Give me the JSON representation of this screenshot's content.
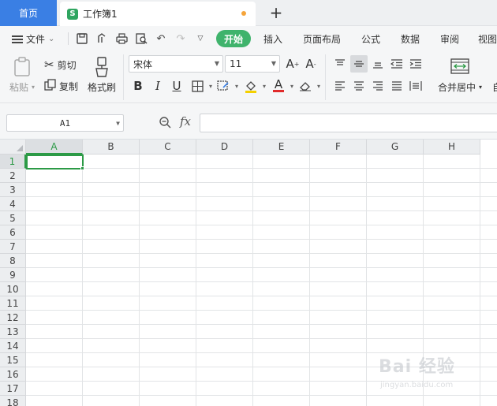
{
  "tabs": {
    "home": "首页",
    "document": "工作簿1"
  },
  "menu": {
    "file": "文件",
    "tabs": [
      {
        "label": "开始",
        "active": true
      },
      {
        "label": "插入"
      },
      {
        "label": "页面布局"
      },
      {
        "label": "公式"
      },
      {
        "label": "数据"
      },
      {
        "label": "审阅"
      },
      {
        "label": "视图"
      }
    ]
  },
  "ribbon": {
    "paste": "粘贴",
    "cut": "剪切",
    "copy": "复制",
    "format_painter": "格式刷",
    "font_name": "宋体",
    "font_size": "11",
    "merge_center": "合并居中",
    "auto_wrap_fragment": "自"
  },
  "formula_bar": {
    "cell_ref": "A1",
    "fx": "fx",
    "content": ""
  },
  "sheet": {
    "columns": [
      "A",
      "B",
      "C",
      "D",
      "E",
      "F",
      "G",
      "H"
    ],
    "rows": [
      "1",
      "2",
      "3",
      "4",
      "5",
      "6",
      "7",
      "8",
      "9",
      "10",
      "11",
      "12",
      "13",
      "14",
      "15",
      "16",
      "17",
      "18"
    ],
    "selected_column": "A",
    "selected_row": "1"
  },
  "watermark": {
    "text": "Bai 经验",
    "url": "jingyan.baidu.com"
  },
  "colors": {
    "accent_green": "#2c9a46",
    "tab_blue": "#3a7fe4",
    "start_tab_green": "#3fb36c"
  }
}
